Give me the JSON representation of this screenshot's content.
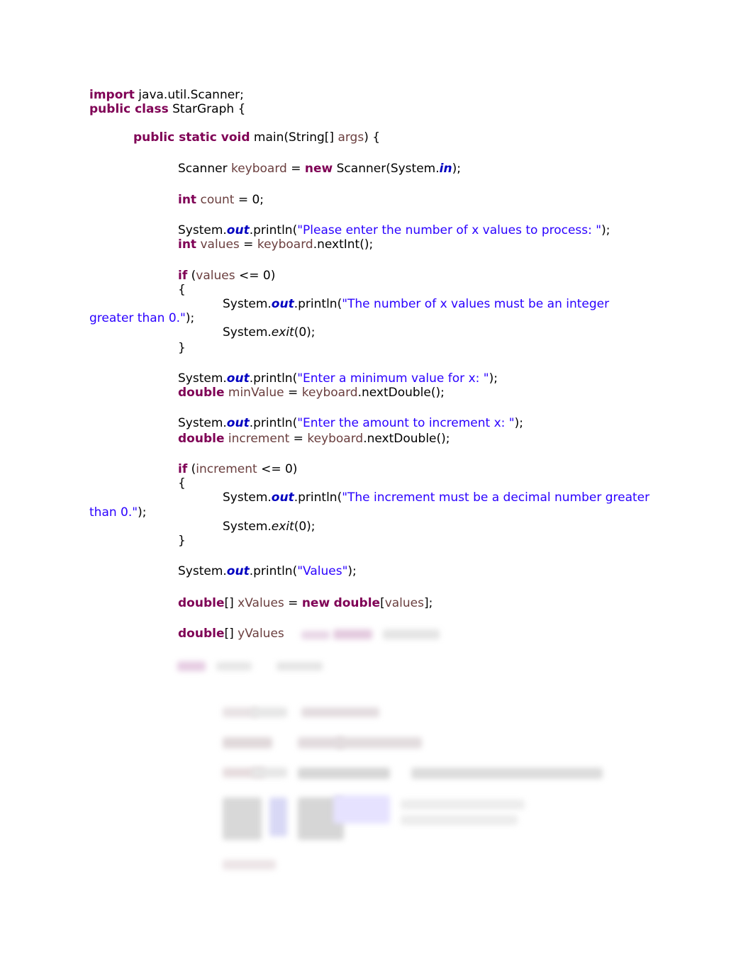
{
  "document": {
    "code": {
      "colors": {
        "keyword": "#7f0055",
        "variable": "#6a3e3e",
        "string": "#2a00ff",
        "field": "#0000c0",
        "plain": "#000000"
      },
      "lines": [
        {
          "tokens": [
            {
              "t": "import",
              "c": "k"
            },
            {
              "t": " java.util.Scanner;",
              "c": "p"
            }
          ]
        },
        {
          "tokens": [
            {
              "t": "public class",
              "c": "k"
            },
            {
              "t": " StarGraph {",
              "c": "p"
            }
          ]
        },
        {
          "tokens": [
            {
              "t": "public static void",
              "c": "k"
            },
            {
              "t": " main(String[] ",
              "c": "p"
            },
            {
              "t": "args",
              "c": "v"
            },
            {
              "t": ") {",
              "c": "p"
            }
          ]
        },
        {
          "tokens": [
            {
              "t": "Scanner ",
              "c": "p"
            },
            {
              "t": "keyboard",
              "c": "v"
            },
            {
              "t": " = ",
              "c": "p"
            },
            {
              "t": "new",
              "c": "k"
            },
            {
              "t": " Scanner(System.",
              "c": "p"
            },
            {
              "t": "in",
              "c": "f"
            },
            {
              "t": ");",
              "c": "p"
            }
          ]
        },
        {
          "tokens": [
            {
              "t": "int",
              "c": "k"
            },
            {
              "t": " ",
              "c": "p"
            },
            {
              "t": "count",
              "c": "v"
            },
            {
              "t": " = 0;",
              "c": "p"
            }
          ]
        },
        {
          "tokens": [
            {
              "t": "System.",
              "c": "p"
            },
            {
              "t": "out",
              "c": "f"
            },
            {
              "t": ".println(",
              "c": "p"
            },
            {
              "t": "\"Please enter the number of x values to process: \"",
              "c": "s"
            },
            {
              "t": ");",
              "c": "p"
            }
          ]
        },
        {
          "tokens": [
            {
              "t": "int",
              "c": "k"
            },
            {
              "t": " ",
              "c": "p"
            },
            {
              "t": "values",
              "c": "v"
            },
            {
              "t": " = ",
              "c": "p"
            },
            {
              "t": "keyboard",
              "c": "v"
            },
            {
              "t": ".nextInt();",
              "c": "p"
            }
          ]
        },
        {
          "tokens": [
            {
              "t": "if",
              "c": "k"
            },
            {
              "t": " (",
              "c": "p"
            },
            {
              "t": "values",
              "c": "v"
            },
            {
              "t": " <= 0)",
              "c": "p"
            }
          ]
        },
        {
          "tokens": [
            {
              "t": "{",
              "c": "p"
            }
          ]
        },
        {
          "tokens": [
            {
              "t": "System.",
              "c": "p"
            },
            {
              "t": "out",
              "c": "f"
            },
            {
              "t": ".println(",
              "c": "p"
            },
            {
              "t": "\"The number of x values must be an integer",
              "c": "s"
            }
          ]
        },
        {
          "tokens": [
            {
              "t": "greater than 0.\"",
              "c": "s"
            },
            {
              "t": ");",
              "c": "p"
            }
          ]
        },
        {
          "tokens": [
            {
              "t": "System.",
              "c": "p"
            },
            {
              "t": "exit",
              "c": "i"
            },
            {
              "t": "(0);",
              "c": "p"
            }
          ]
        },
        {
          "tokens": [
            {
              "t": "}",
              "c": "p"
            }
          ]
        },
        {
          "tokens": [
            {
              "t": "System.",
              "c": "p"
            },
            {
              "t": "out",
              "c": "f"
            },
            {
              "t": ".println(",
              "c": "p"
            },
            {
              "t": "\"Enter a minimum value for x: \"",
              "c": "s"
            },
            {
              "t": ");",
              "c": "p"
            }
          ]
        },
        {
          "tokens": [
            {
              "t": "double",
              "c": "k"
            },
            {
              "t": " ",
              "c": "p"
            },
            {
              "t": "minValue",
              "c": "v"
            },
            {
              "t": " = ",
              "c": "p"
            },
            {
              "t": "keyboard",
              "c": "v"
            },
            {
              "t": ".nextDouble();",
              "c": "p"
            }
          ]
        },
        {
          "tokens": [
            {
              "t": "System.",
              "c": "p"
            },
            {
              "t": "out",
              "c": "f"
            },
            {
              "t": ".println(",
              "c": "p"
            },
            {
              "t": "\"Enter the amount to increment x: \"",
              "c": "s"
            },
            {
              "t": ");",
              "c": "p"
            }
          ]
        },
        {
          "tokens": [
            {
              "t": "double",
              "c": "k"
            },
            {
              "t": " ",
              "c": "p"
            },
            {
              "t": "increment",
              "c": "v"
            },
            {
              "t": " = ",
              "c": "p"
            },
            {
              "t": "keyboard",
              "c": "v"
            },
            {
              "t": ".nextDouble();",
              "c": "p"
            }
          ]
        },
        {
          "tokens": [
            {
              "t": "if",
              "c": "k"
            },
            {
              "t": " (",
              "c": "p"
            },
            {
              "t": "increment",
              "c": "v"
            },
            {
              "t": " <= 0)",
              "c": "p"
            }
          ]
        },
        {
          "tokens": [
            {
              "t": "{",
              "c": "p"
            }
          ]
        },
        {
          "tokens": [
            {
              "t": "System.",
              "c": "p"
            },
            {
              "t": "out",
              "c": "f"
            },
            {
              "t": ".println(",
              "c": "p"
            },
            {
              "t": "\"The increment must be a decimal number greater",
              "c": "s"
            }
          ]
        },
        {
          "tokens": [
            {
              "t": "than 0.\"",
              "c": "s"
            },
            {
              "t": ");",
              "c": "p"
            }
          ]
        },
        {
          "tokens": [
            {
              "t": "System.",
              "c": "p"
            },
            {
              "t": "exit",
              "c": "i"
            },
            {
              "t": "(0);",
              "c": "p"
            }
          ]
        },
        {
          "tokens": [
            {
              "t": "}",
              "c": "p"
            }
          ]
        },
        {
          "tokens": [
            {
              "t": "System.",
              "c": "p"
            },
            {
              "t": "out",
              "c": "f"
            },
            {
              "t": ".println(",
              "c": "p"
            },
            {
              "t": "\"Values\"",
              "c": "s"
            },
            {
              "t": ");",
              "c": "p"
            }
          ]
        },
        {
          "tokens": [
            {
              "t": "double",
              "c": "k"
            },
            {
              "t": "[] ",
              "c": "p"
            },
            {
              "t": "xValues",
              "c": "v"
            },
            {
              "t": " = ",
              "c": "p"
            },
            {
              "t": "new",
              "c": "k"
            },
            {
              "t": " ",
              "c": "p"
            },
            {
              "t": "double",
              "c": "k"
            },
            {
              "t": "[",
              "c": "p"
            },
            {
              "t": "values",
              "c": "v"
            },
            {
              "t": "];",
              "c": "p"
            }
          ]
        },
        {
          "tokens": [
            {
              "t": "double",
              "c": "k"
            },
            {
              "t": "[] ",
              "c": "p"
            },
            {
              "t": "yValues",
              "c": "v"
            }
          ]
        }
      ]
    }
  }
}
